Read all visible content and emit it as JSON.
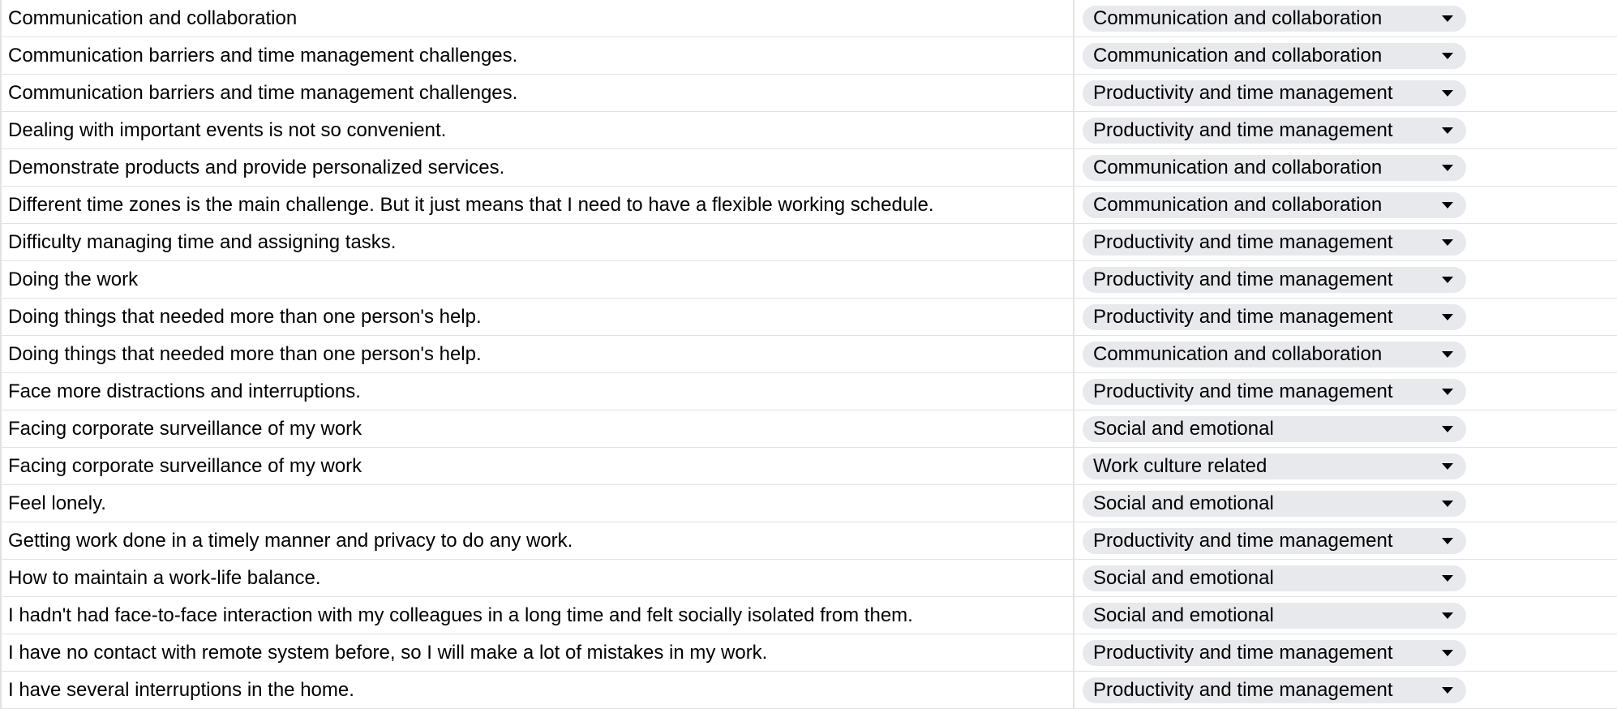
{
  "rows": [
    {
      "text": "Communication and collaboration",
      "category": "Communication and collaboration"
    },
    {
      "text": "Communication barriers and time management challenges.",
      "category": "Communication and collaboration"
    },
    {
      "text": "Communication barriers and time management challenges.",
      "category": "Productivity and time management"
    },
    {
      "text": "Dealing with important events is not so convenient.",
      "category": "Productivity and time management"
    },
    {
      "text": "Demonstrate products and provide personalized services.",
      "category": "Communication and collaboration"
    },
    {
      "text": "Different time zones is the main challenge. But it just means that I need to have a flexible working schedule.",
      "category": "Communication and collaboration"
    },
    {
      "text": "Difficulty managing time and assigning tasks.",
      "category": "Productivity and time management"
    },
    {
      "text": "Doing the work",
      "category": "Productivity and time management"
    },
    {
      "text": "Doing things that needed more than one person's help.",
      "category": "Productivity and time management"
    },
    {
      "text": "Doing things that needed more than one person's help.",
      "category": "Communication and collaboration"
    },
    {
      "text": "Face more distractions and interruptions.",
      "category": "Productivity and time management"
    },
    {
      "text": "Facing corporate surveillance of my work",
      "category": "Social and emotional"
    },
    {
      "text": "Facing corporate surveillance of my work",
      "category": "Work culture related"
    },
    {
      "text": "Feel lonely.",
      "category": "Social and emotional"
    },
    {
      "text": "Getting work done in a timely manner and privacy to do any work.",
      "category": "Productivity and time management"
    },
    {
      "text": "How to maintain a work-life balance.",
      "category": "Social and emotional"
    },
    {
      "text": "I hadn't had face-to-face interaction with my colleagues in a long time and felt socially isolated from them.",
      "category": "Social and emotional"
    },
    {
      "text": "I have no contact with remote system before, so I will make a lot of mistakes in my work.",
      "category": "Productivity and time management"
    },
    {
      "text": "I have several interruptions in the home.",
      "category": "Productivity and time management"
    }
  ],
  "colors": {
    "chip_bg": "#e8e9ed",
    "gridline": "#e2e2e2"
  },
  "icons": {
    "dropdown": "caret-down-icon"
  }
}
